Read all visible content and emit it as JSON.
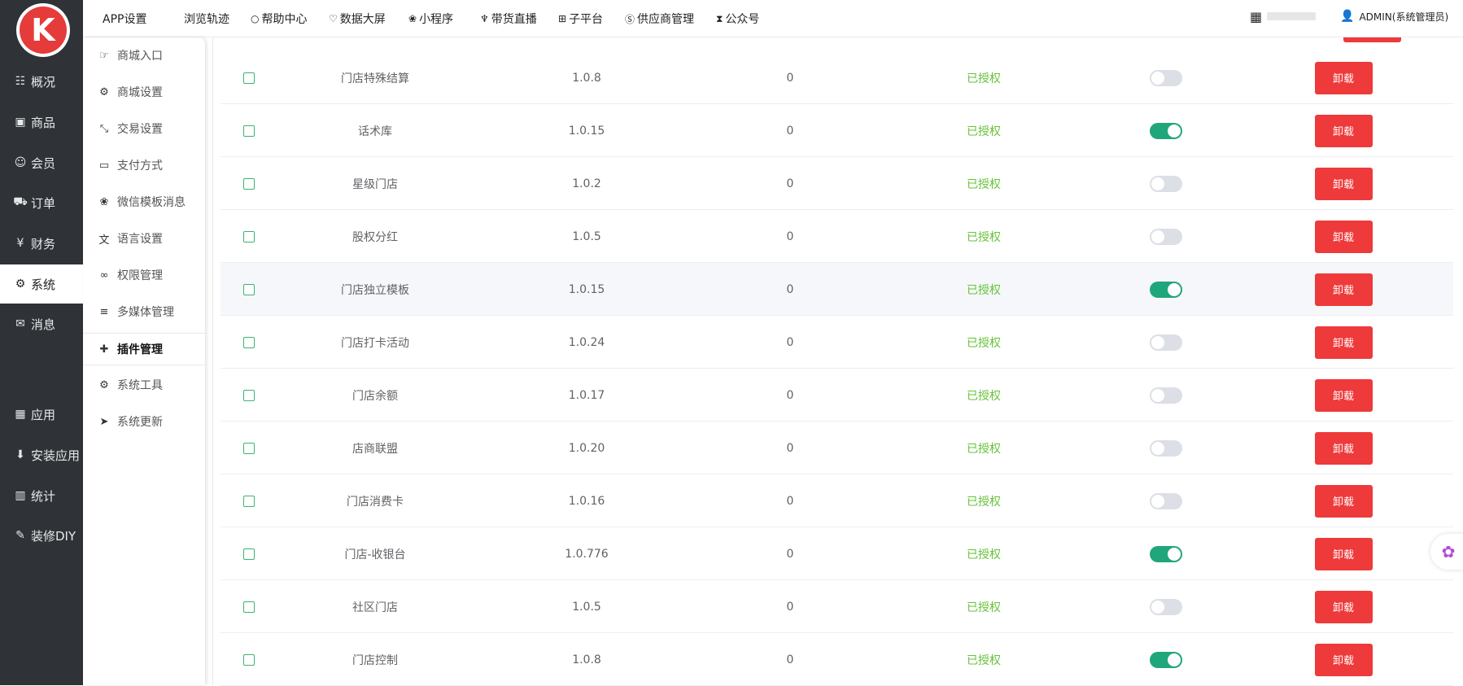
{
  "brand": {
    "logo_letter": "K"
  },
  "sidebar": {
    "items": [
      {
        "label": "概况",
        "icon": "overview-icon",
        "glyph": "☷"
      },
      {
        "label": "商品",
        "icon": "goods-icon",
        "glyph": "▣"
      },
      {
        "label": "会员",
        "icon": "member-icon",
        "glyph": "☺"
      },
      {
        "label": "订单",
        "icon": "cart-icon",
        "glyph": "⛟"
      },
      {
        "label": "财务",
        "icon": "finance-icon",
        "glyph": "¥"
      },
      {
        "label": "系统",
        "icon": "gear-icon",
        "glyph": "⚙",
        "active": true
      },
      {
        "label": "消息",
        "icon": "message-icon",
        "glyph": "✉"
      },
      {
        "label": "应用",
        "icon": "apps-icon",
        "glyph": "▦"
      },
      {
        "label": "安装应用",
        "icon": "install-icon",
        "glyph": "⬇"
      },
      {
        "label": "统计",
        "icon": "stats-icon",
        "glyph": "▥"
      },
      {
        "label": "装修DIY",
        "icon": "paint-icon",
        "glyph": "✎"
      }
    ]
  },
  "submenu": {
    "items": [
      {
        "label": "商城入口",
        "icon": "hand-point-icon",
        "glyph": "☞"
      },
      {
        "label": "商城设置",
        "icon": "gear-icon",
        "glyph": "⚙"
      },
      {
        "label": "交易设置",
        "icon": "compress-icon",
        "glyph": "⤡"
      },
      {
        "label": "支付方式",
        "icon": "credit-card-icon",
        "glyph": "▭"
      },
      {
        "label": "微信模板消息",
        "icon": "wechat-icon",
        "glyph": "❀"
      },
      {
        "label": "语言设置",
        "icon": "language-icon",
        "glyph": "文"
      },
      {
        "label": "权限管理",
        "icon": "link-icon",
        "glyph": "∞"
      },
      {
        "label": "多媒体管理",
        "icon": "list-icon",
        "glyph": "≡"
      },
      {
        "label": "插件管理",
        "icon": "puzzle-icon",
        "glyph": "✚",
        "active": true
      },
      {
        "label": "系统工具",
        "icon": "gear-icon",
        "glyph": "⚙"
      },
      {
        "label": "系统更新",
        "icon": "paper-plane-icon",
        "glyph": "➤"
      }
    ]
  },
  "topnav": {
    "items": [
      {
        "label": "APP设置",
        "icon": "apple-icon",
        "glyph": ""
      },
      {
        "label": "浏览轨迹",
        "icon": "",
        "glyph": ""
      },
      {
        "label": "帮助中心",
        "icon": "circle-icon",
        "glyph": "○"
      },
      {
        "label": "数据大屏",
        "icon": "heart-icon",
        "glyph": "♡"
      },
      {
        "label": "小程序",
        "icon": "wechat-icon",
        "glyph": "❀"
      },
      {
        "label": "带货直播",
        "icon": "live-icon",
        "glyph": "♆"
      },
      {
        "label": "子平台",
        "icon": "plus-square-icon",
        "glyph": "⊞"
      },
      {
        "label": "供应商管理",
        "icon": "skype-icon",
        "glyph": "Ⓢ"
      },
      {
        "label": "公众号",
        "icon": "hourglass-icon",
        "glyph": "⧗"
      }
    ],
    "user": "ADMIN(系统管理员)"
  },
  "table": {
    "uninstall_label": "卸载",
    "rows": [
      {
        "name": "门店特殊结算",
        "version": "1.0.8",
        "count": "0",
        "status": "已授权",
        "enabled": false
      },
      {
        "name": "话术库",
        "version": "1.0.15",
        "count": "0",
        "status": "已授权",
        "enabled": true
      },
      {
        "name": "星级门店",
        "version": "1.0.2",
        "count": "0",
        "status": "已授权",
        "enabled": false
      },
      {
        "name": "股权分红",
        "version": "1.0.5",
        "count": "0",
        "status": "已授权",
        "enabled": false
      },
      {
        "name": "门店独立模板",
        "version": "1.0.15",
        "count": "0",
        "status": "已授权",
        "enabled": true
      },
      {
        "name": "门店打卡活动",
        "version": "1.0.24",
        "count": "0",
        "status": "已授权",
        "enabled": false
      },
      {
        "name": "门店余额",
        "version": "1.0.17",
        "count": "0",
        "status": "已授权",
        "enabled": false
      },
      {
        "name": "店商联盟",
        "version": "1.0.20",
        "count": "0",
        "status": "已授权",
        "enabled": false
      },
      {
        "name": "门店消费卡",
        "version": "1.0.16",
        "count": "0",
        "status": "已授权",
        "enabled": false
      },
      {
        "name": "门店-收银台",
        "version": "1.0.776",
        "count": "0",
        "status": "已授权",
        "enabled": true
      },
      {
        "name": "社区门店",
        "version": "1.0.5",
        "count": "0",
        "status": "已授权",
        "enabled": false
      },
      {
        "name": "门店控制",
        "version": "1.0.8",
        "count": "0",
        "status": "已授权",
        "enabled": true
      }
    ]
  },
  "colors": {
    "sidebar_bg": "#2f3338",
    "danger": "#ee3a3a",
    "switch_on": "#1fa67a",
    "authorized": "#67c23a"
  }
}
